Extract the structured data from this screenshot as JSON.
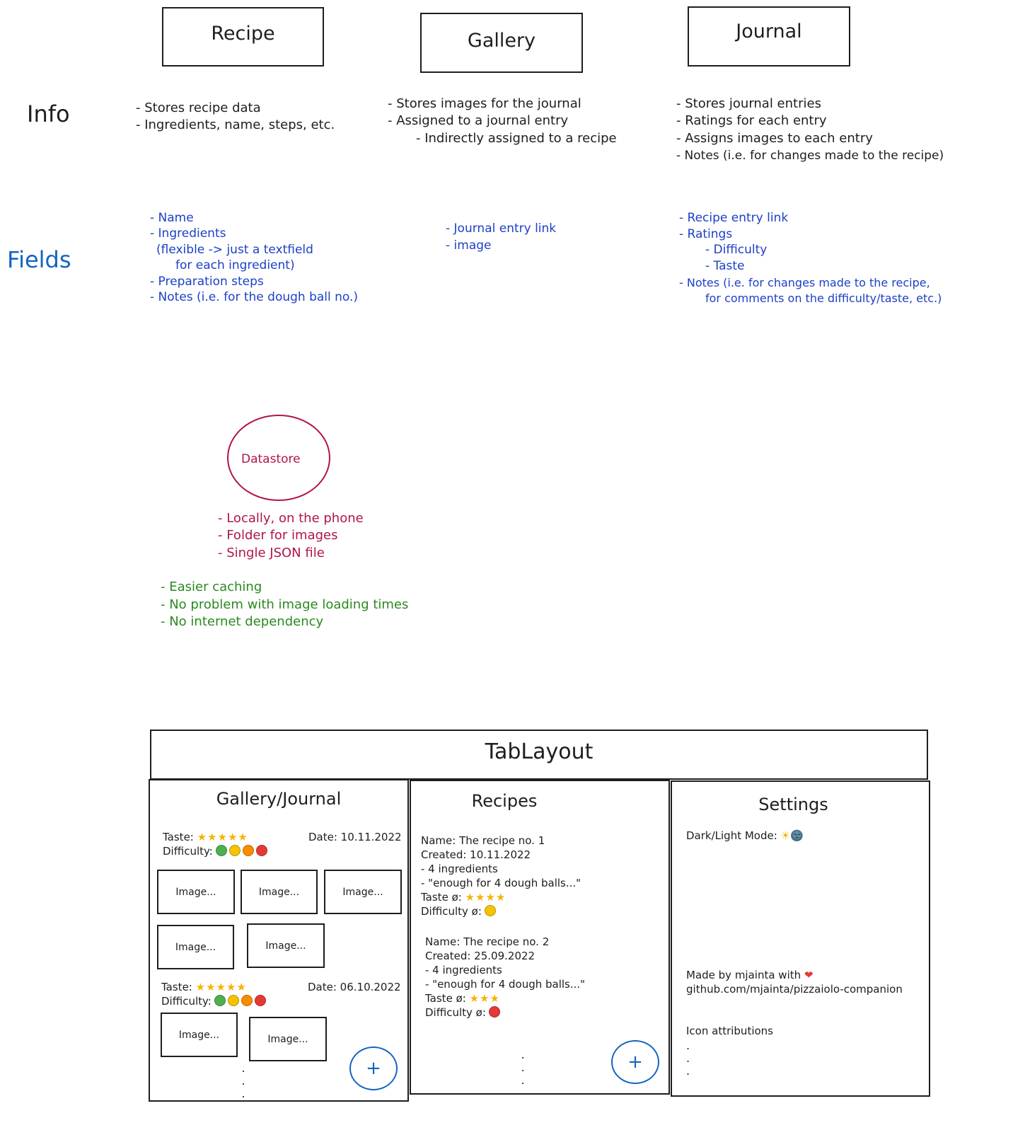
{
  "top_boxes": {
    "recipe": "Recipe",
    "gallery": "Gallery",
    "journal": "Journal"
  },
  "labels": {
    "info": "Info",
    "fields": "Fields"
  },
  "info": {
    "recipe": [
      "- Stores recipe data",
      "- Ingredients, name, steps, etc."
    ],
    "gallery": [
      "- Stores images for the journal",
      "- Assigned to a journal entry",
      "- Indirectly assigned to a recipe"
    ],
    "journal": [
      "- Stores journal entries",
      "- Ratings for each entry",
      "- Assigns images to each entry",
      "- Notes (i.e. for changes made to the recipe)"
    ]
  },
  "fields": {
    "recipe": [
      "- Name",
      "- Ingredients",
      "(flexible -> just a textfield",
      "for each ingredient)",
      "- Preparation steps",
      "- Notes (i.e. for the dough ball no.)"
    ],
    "gallery": [
      "- Journal entry link",
      "- image"
    ],
    "journal": [
      "- Recipe entry link",
      "- Ratings",
      "- Difficulty",
      "- Taste",
      "- Notes (i.e. for changes made to the recipe,",
      "for comments on the difficulty/taste, etc.)"
    ]
  },
  "datastore": {
    "title": "Datastore",
    "items": [
      "- Locally, on the phone",
      "- Folder for images",
      "- Single JSON file"
    ],
    "benefits": [
      "- Easier caching",
      "- No problem with image loading times",
      "- No internet dependency"
    ]
  },
  "colors": {
    "ink": "#1e1e1e",
    "fields_blue": "#1c3fc7",
    "datastore_red": "#b0144e",
    "benefit_green": "#2b8a1e",
    "fab_blue": "#1565c0"
  },
  "mockup": {
    "tab_layout_title": "TabLayout",
    "gallery": {
      "title": "Gallery/Journal",
      "entries": [
        {
          "taste_label": "Taste:",
          "taste_stars": "★★★★★",
          "date": "Date: 10.11.2022",
          "difficulty_label": "Difficulty:",
          "images": [
            "Image...",
            "Image...",
            "Image...",
            "Image...",
            "Image..."
          ]
        },
        {
          "taste_label": "Taste:",
          "taste_stars": "★★★★★",
          "date": "Date: 06.10.2022",
          "difficulty_label": "Difficulty:",
          "images": [
            "Image...",
            "Image..."
          ]
        }
      ],
      "difficulty_colors": [
        "#4caf50",
        "#f5c400",
        "#fb8c00",
        "#e53935"
      ],
      "add_icon": "plus-icon",
      "add_glyph": "+",
      "more": "."
    },
    "recipes": {
      "title": "Recipes",
      "items": [
        {
          "name": "Name: The recipe no. 1",
          "created": "Created: 10.11.2022",
          "ingredients": "- 4 ingredients",
          "note": "- \"enough for 4 dough balls...\"",
          "taste_label": "Taste ø:",
          "taste_stars": "★★★★",
          "difficulty_label": "Difficulty ø:",
          "difficulty_color": "#f5c400"
        },
        {
          "name": "Name: The recipe no. 2",
          "created": "Created: 25.09.2022",
          "ingredients": "- 4 ingredients",
          "note": "- \"enough for 4 dough balls...\"",
          "taste_label": "Taste ø:",
          "taste_stars": "★★★",
          "difficulty_label": "Difficulty ø:",
          "difficulty_color": "#e53935"
        }
      ],
      "add_glyph": "+",
      "more": "."
    },
    "settings": {
      "title": "Settings",
      "dark_light_label": "Dark/Light Mode:",
      "sun_glyph": "☀",
      "moon_glyph": "🌚",
      "made_by": "Made by mjainta with",
      "heart_glyph": "❤",
      "repo": "github.com/mjainta/pizzaiolo-companion",
      "icon_attributions": "Icon attributions",
      "more": "."
    }
  }
}
